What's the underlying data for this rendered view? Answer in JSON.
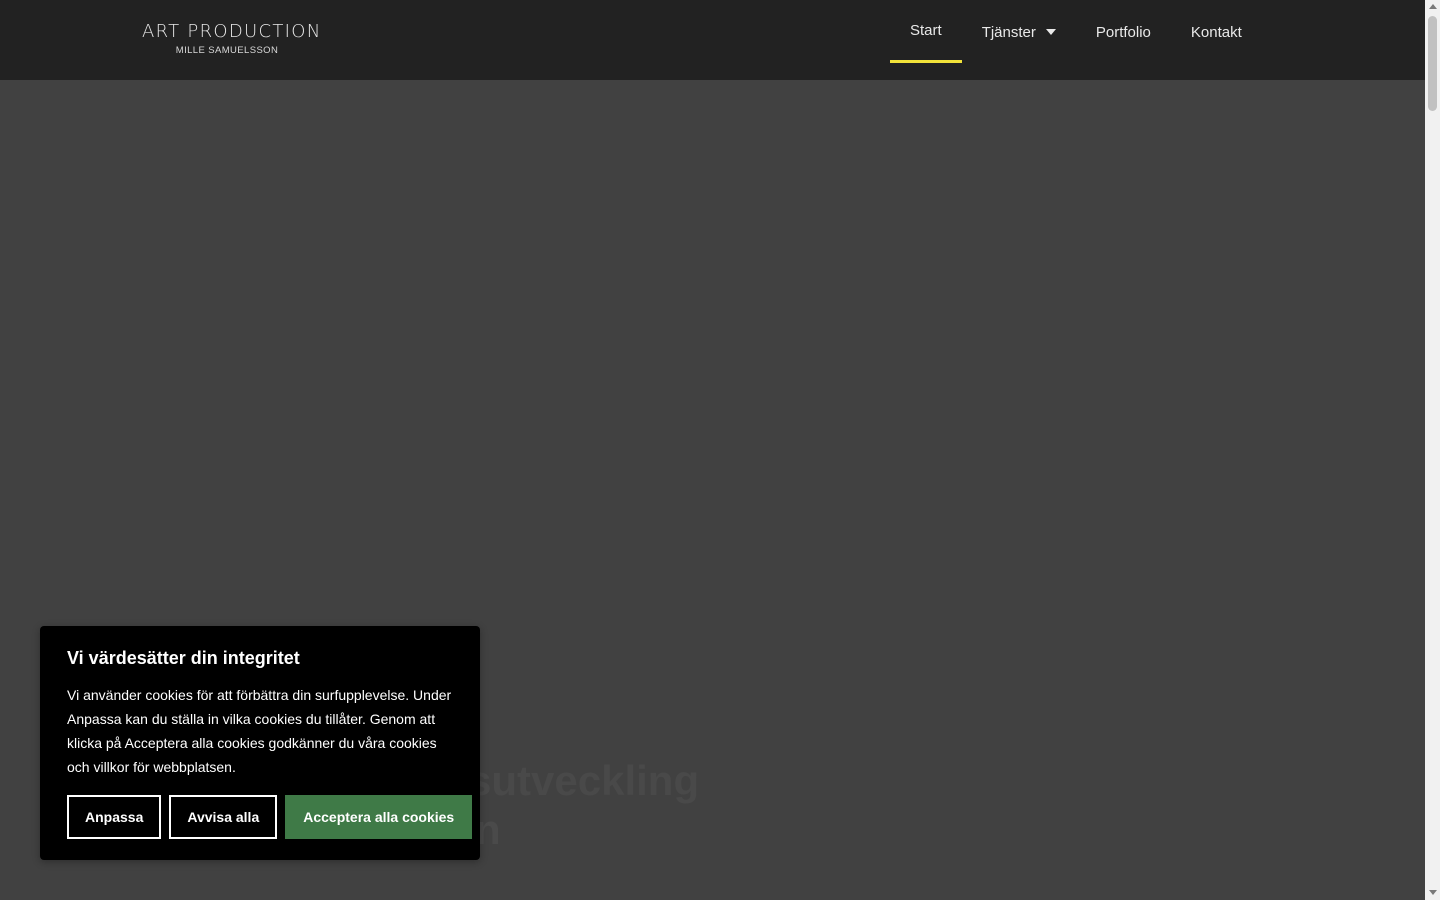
{
  "header": {
    "logo_title": "ART PRODUCTION",
    "logo_subtitle": "MILLE SAMUELSSON",
    "nav": [
      {
        "label": "Start",
        "active": true
      },
      {
        "label": "Tjänster",
        "has_dropdown": true
      },
      {
        "label": "Portfolio"
      },
      {
        "label": "Kontakt"
      }
    ],
    "accent_color": "#f2e33a"
  },
  "hero": {
    "line1_partial": "lrsutveckling",
    "line2_partial": "n"
  },
  "cookie_banner": {
    "title": "Vi värdesätter din integritet",
    "text": "Vi använder cookies för att förbättra din surfupplevelse. Under Anpassa kan du ställa in vilka cookies du tillåter. Genom att klicka på Acceptera alla cookies godkänner du våra cookies och villkor för webbplatsen.",
    "customize_label": "Anpassa",
    "reject_label": "Avvisa alla",
    "accept_label": "Acceptera alla cookies",
    "accept_color": "#3f7a47"
  }
}
